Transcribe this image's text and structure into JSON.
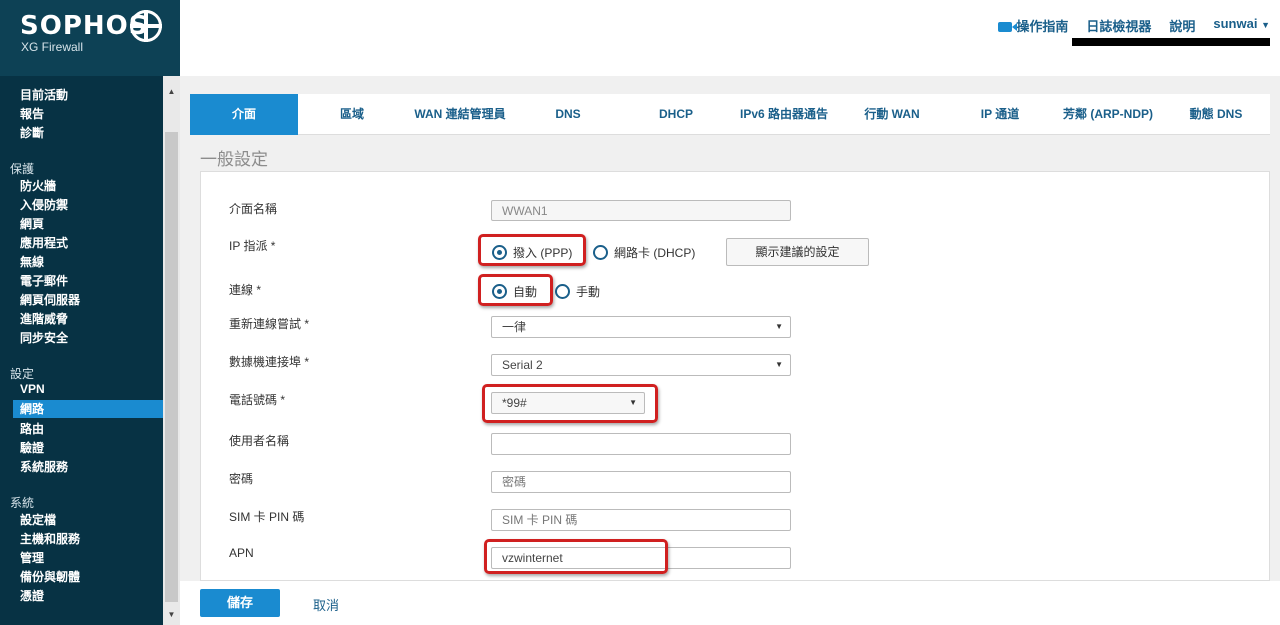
{
  "brand": {
    "logo": "SOPHOS",
    "product": "XG Firewall"
  },
  "sidebar": {
    "top_items": [
      "目前活動",
      "報告",
      "診斷"
    ],
    "groups": [
      {
        "label": "保護",
        "items": [
          "防火牆",
          "入侵防禦",
          "網頁",
          "應用程式",
          "無線",
          "電子郵件",
          "網頁伺服器",
          "進階威脅",
          "同步安全"
        ]
      },
      {
        "label": "設定",
        "items": [
          "VPN",
          "網路",
          "路由",
          "驗證",
          "系統服務"
        ]
      },
      {
        "label": "系統",
        "items": [
          "設定檔",
          "主機和服務",
          "管理",
          "備份與韌體",
          "憑證"
        ]
      }
    ],
    "active_item": "網路"
  },
  "header": {
    "guide": "操作指南",
    "log_viewer": "日誌檢視器",
    "help": "說明",
    "user": "sunwai"
  },
  "tabs": [
    "介面",
    "區域",
    "WAN 連結管理員",
    "DNS",
    "DHCP",
    "IPv6 路由器通告",
    "行動 WAN",
    "IP 通道",
    "芳鄰 (ARP-NDP)",
    "動態 DNS"
  ],
  "active_tab": "介面",
  "section_title": "一般設定",
  "form": {
    "interface_name": {
      "label": "介面名稱",
      "value": "WWAN1"
    },
    "ip_assignment": {
      "label": "IP 指派 *",
      "opt1": "撥入 (PPP)",
      "opt2": "網路卡 (DHCP)",
      "selected": "撥入 (PPP)",
      "suggest_button": "顯示建議的設定"
    },
    "connection": {
      "label": "連線 *",
      "opt1": "自動",
      "opt2": "手動",
      "selected": "自動"
    },
    "reconnect": {
      "label": "重新連線嘗試 *",
      "value": "一律"
    },
    "modem_port": {
      "label": "數據機連接埠 *",
      "value": "Serial 2"
    },
    "phone": {
      "label": "電話號碼 *",
      "value": "*99#"
    },
    "username": {
      "label": "使用者名稱",
      "value": ""
    },
    "password": {
      "label": "密碼",
      "placeholder": "密碼"
    },
    "sim_pin": {
      "label": "SIM 卡 PIN 碼",
      "placeholder": "SIM 卡 PIN 碼"
    },
    "apn": {
      "label": "APN",
      "value": "vzwinternet"
    }
  },
  "footer": {
    "save": "儲存",
    "cancel": "取消"
  }
}
